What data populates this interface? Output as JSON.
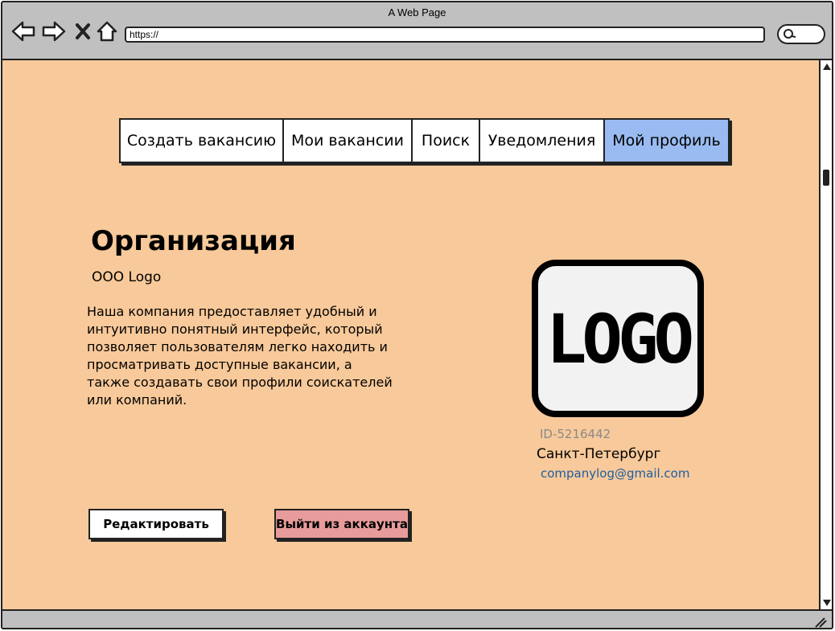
{
  "window": {
    "title": "A Web Page",
    "url": "https://"
  },
  "tabs": [
    {
      "label": "Создать вакансию",
      "active": false
    },
    {
      "label": "Мои вакансии",
      "active": false
    },
    {
      "label": "Поиск",
      "active": false
    },
    {
      "label": "Уведомления",
      "active": false
    },
    {
      "label": "Мой профиль",
      "active": true
    }
  ],
  "profile": {
    "heading": "Организация",
    "name": "ООО Logo",
    "description": "Наша компания предоставляет удобный и интуитивно понятный интерфейс, который позволяет пользователям легко находить и просматривать доступные вакансии, а также создавать свои профили соискателей или компаний.",
    "logo_text": "LOGO",
    "id": "ID-5216442",
    "city": "Санкт-Петербург",
    "email": "companylog@gmail.com"
  },
  "actions": {
    "edit_label": "Редактировать",
    "logout_label": "Выйти из аккаунта"
  },
  "colors": {
    "background": "#f8c99a",
    "active_tab": "#99bbf1",
    "logout_button": "#e89b9b",
    "email_link": "#1c5fa3",
    "id_text": "#8a8a8a"
  },
  "icons": [
    "back-icon",
    "forward-icon",
    "close-icon",
    "home-icon",
    "search-icon",
    "scroll-up-icon",
    "scroll-down-icon",
    "resize-grip-icon"
  ]
}
